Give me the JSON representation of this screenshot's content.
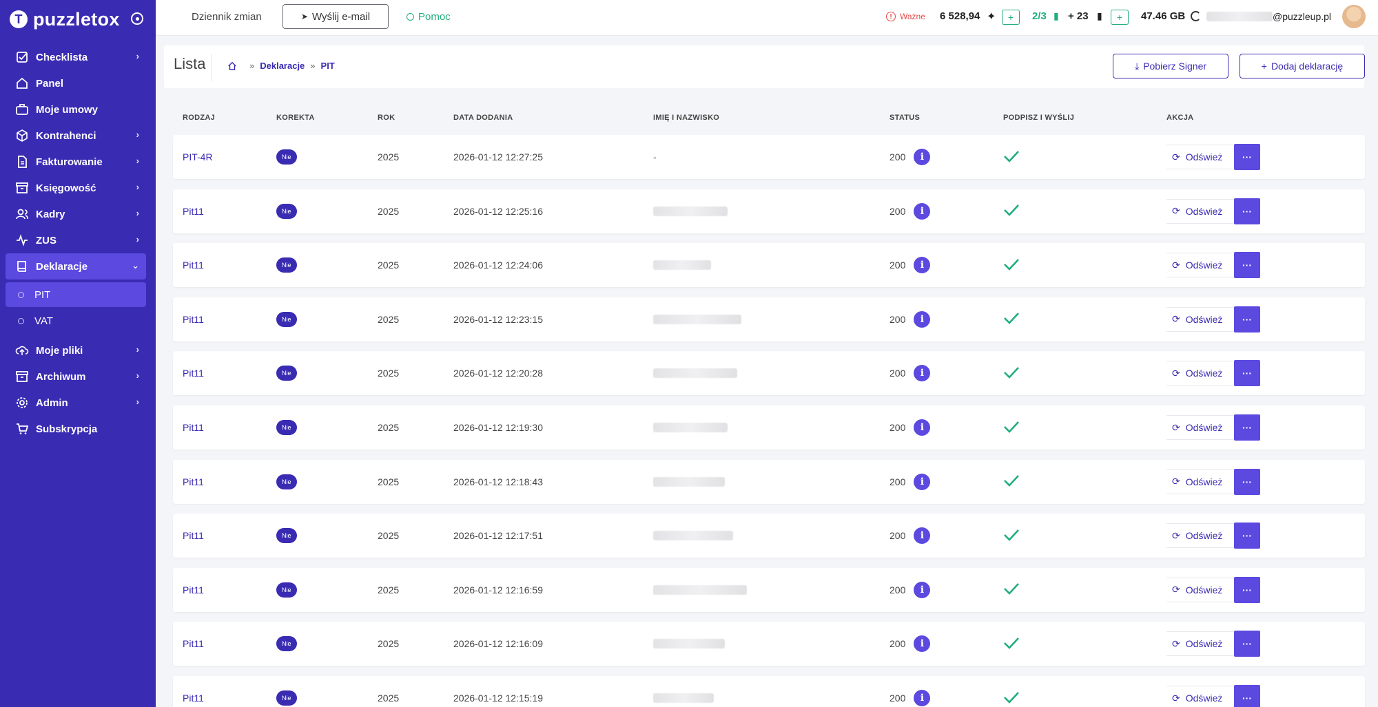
{
  "brand": {
    "name": "puzzletox"
  },
  "sidebar": {
    "items": [
      {
        "label": "Checklista",
        "icon": "checklist-icon",
        "chevron": true
      },
      {
        "label": "Panel",
        "icon": "home-icon",
        "chevron": false
      },
      {
        "label": "Moje umowy",
        "icon": "briefcase-icon",
        "chevron": false
      },
      {
        "label": "Kontrahenci",
        "icon": "box-icon",
        "chevron": true
      },
      {
        "label": "Fakturowanie",
        "icon": "document-icon",
        "chevron": true
      },
      {
        "label": "Księgowość",
        "icon": "archive-icon",
        "chevron": true
      },
      {
        "label": "Kadry",
        "icon": "users-icon",
        "chevron": true
      },
      {
        "label": "ZUS",
        "icon": "pulse-icon",
        "chevron": true
      },
      {
        "label": "Deklaracje",
        "icon": "book-icon",
        "chevron": true,
        "active": true
      },
      {
        "label": "Moje pliki",
        "icon": "upload-cloud-icon",
        "chevron": true
      },
      {
        "label": "Archiwum",
        "icon": "archive-icon",
        "chevron": true
      },
      {
        "label": "Admin",
        "icon": "gear-icon",
        "chevron": true
      },
      {
        "label": "Subskrypcja",
        "icon": "cart-icon",
        "chevron": false
      }
    ],
    "subitems": [
      {
        "label": "PIT",
        "active": true
      },
      {
        "label": "VAT",
        "active": false
      }
    ]
  },
  "topbar": {
    "changelog": "Dziennik zmian",
    "send_email": "Wyślij e-mail",
    "help": "Pomoc",
    "important": "Ważne",
    "balance": "6 528,94",
    "docs_ratio": "2/3",
    "docs_extra": "+ 23",
    "plus": "+",
    "storage": "47.46 GB",
    "email_suffix": "@puzzleup.pl"
  },
  "page": {
    "title": "Lista",
    "breadcrumb": [
      "Deklaracje",
      "PIT"
    ],
    "btn_signer": "Pobierz Signer",
    "btn_add": "Dodaj deklarację"
  },
  "table": {
    "headers": [
      "RODZAJ",
      "KOREKTA",
      "ROK",
      "DATA DODANIA",
      "IMIĘ I NAZWISKO",
      "STATUS",
      "PODPISZ I WYŚLIJ",
      "AKCJA"
    ],
    "refresh_label": "Odśwież",
    "more_label": "···",
    "rows": [
      {
        "type": "PIT-4R",
        "correction": "Nie",
        "year": "2025",
        "date": "2026-01-12 12:27:25",
        "name": "-",
        "status": "200"
      },
      {
        "type": "Pit11",
        "correction": "Nie",
        "year": "2025",
        "date": "2026-01-12 12:25:16",
        "name": "",
        "status": "200"
      },
      {
        "type": "Pit11",
        "correction": "Nie",
        "year": "2025",
        "date": "2026-01-12 12:24:06",
        "name": "",
        "status": "200"
      },
      {
        "type": "Pit11",
        "correction": "Nie",
        "year": "2025",
        "date": "2026-01-12 12:23:15",
        "name": "",
        "status": "200"
      },
      {
        "type": "Pit11",
        "correction": "Nie",
        "year": "2025",
        "date": "2026-01-12 12:20:28",
        "name": "",
        "status": "200"
      },
      {
        "type": "Pit11",
        "correction": "Nie",
        "year": "2025",
        "date": "2026-01-12 12:19:30",
        "name": "",
        "status": "200"
      },
      {
        "type": "Pit11",
        "correction": "Nie",
        "year": "2025",
        "date": "2026-01-12 12:18:43",
        "name": "",
        "status": "200"
      },
      {
        "type": "Pit11",
        "correction": "Nie",
        "year": "2025",
        "date": "2026-01-12 12:17:51",
        "name": "",
        "status": "200"
      },
      {
        "type": "Pit11",
        "correction": "Nie",
        "year": "2025",
        "date": "2026-01-12 12:16:59",
        "name": "",
        "status": "200"
      },
      {
        "type": "Pit11",
        "correction": "Nie",
        "year": "2025",
        "date": "2026-01-12 12:16:09",
        "name": "",
        "status": "200"
      },
      {
        "type": "Pit11",
        "correction": "Nie",
        "year": "2025",
        "date": "2026-01-12 12:15:19",
        "name": "",
        "status": "200"
      }
    ]
  },
  "colors": {
    "primary": "#3a2bb3",
    "accent": "#5b49e0",
    "success": "#1fae7a",
    "danger": "#e24848"
  }
}
